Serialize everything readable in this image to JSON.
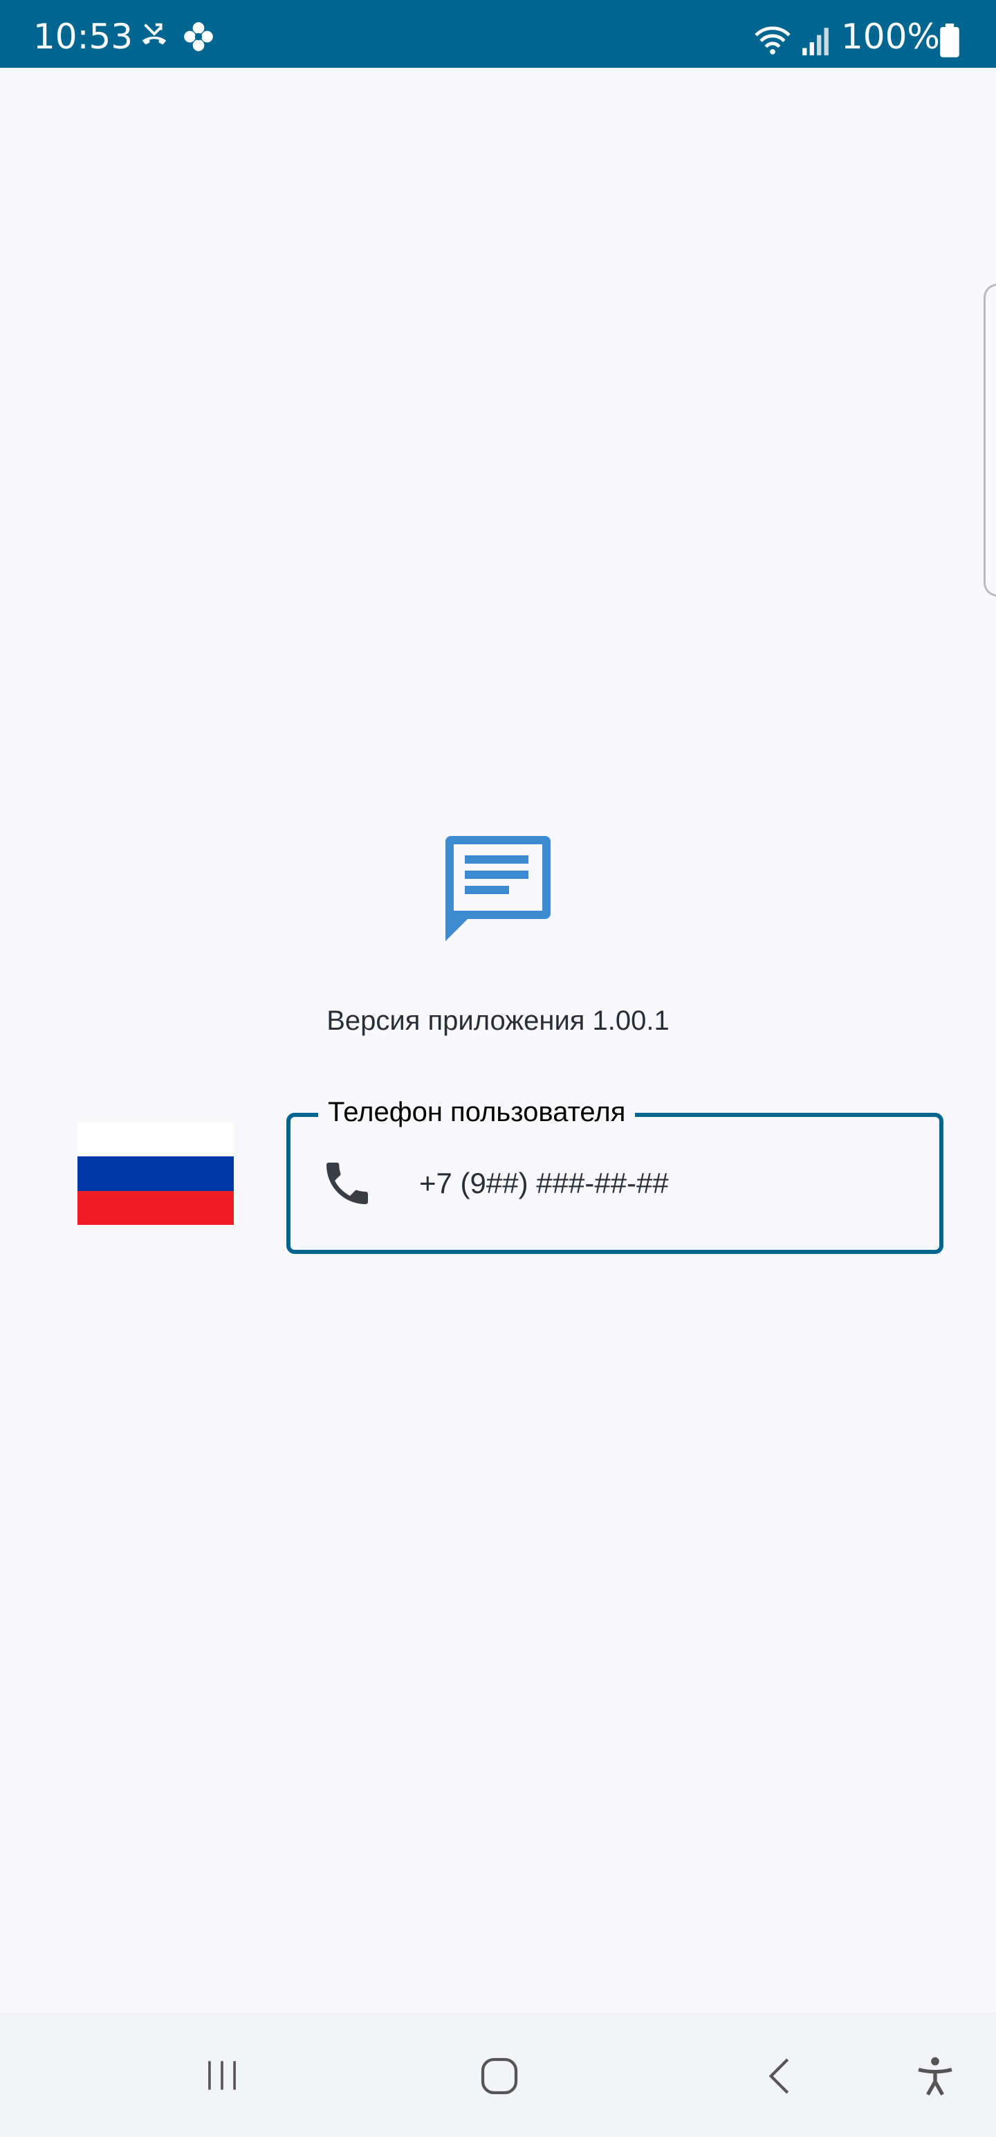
{
  "status_bar": {
    "time": "10:53",
    "battery": "100%",
    "left_icons": [
      "missed-call-icon",
      "flower-icon"
    ],
    "right_icons": [
      "wifi-icon",
      "signal-icon",
      "battery-icon"
    ],
    "color": "#01668f"
  },
  "logo": {
    "icon": "chat-message-icon",
    "color": "#3e8ad1"
  },
  "version_text": "Версия приложения 1.00.1",
  "country_flag": {
    "icon": "russia-flag",
    "colors": [
      "#ffffff",
      "#0039a6",
      "#ee1c25"
    ]
  },
  "phone_field": {
    "label": "Телефон пользователя",
    "placeholder": "+7 (9##) ###-##-##",
    "icon": "phone-icon",
    "border_color": "#01668f"
  },
  "nav_bar": {
    "buttons": [
      "recent-apps-icon",
      "home-icon",
      "back-icon",
      "accessibility-icon"
    ]
  }
}
